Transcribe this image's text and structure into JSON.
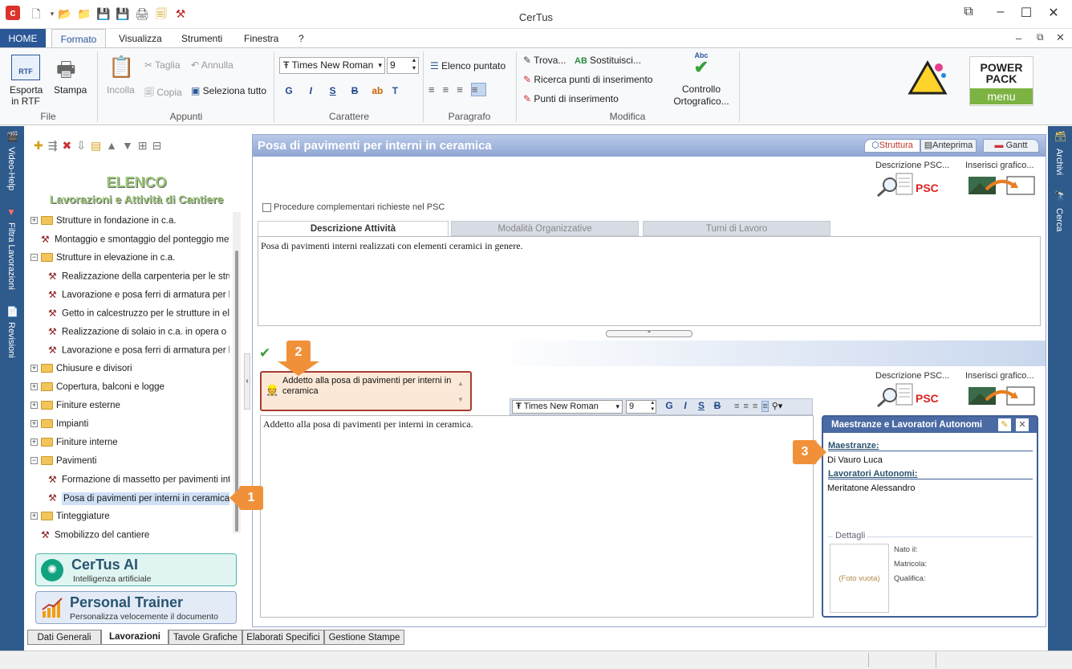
{
  "window": {
    "title": "CerTus"
  },
  "ribbon_tabs": [
    "HOME",
    "Formato",
    "Visualizza",
    "Strumenti",
    "Finestra",
    "?"
  ],
  "ribbon": {
    "file": {
      "label": "File",
      "esporta": [
        "Esporta",
        "in RTF"
      ],
      "stampa": "Stampa"
    },
    "appunti": {
      "label": "Appunti",
      "incolla": "Incolla",
      "taglia": "Taglia",
      "annulla": "Annulla",
      "copia": "Copia",
      "seleziona": "Seleziona tutto"
    },
    "carattere": {
      "label": "Carattere",
      "font": "Times New Roman",
      "size": "9",
      "styles": [
        "G",
        "I",
        "S",
        "B"
      ]
    },
    "paragrafo": {
      "label": "Paragrafo",
      "elenco": "Elenco puntato"
    },
    "modifica": {
      "label": "Modifica",
      "trova": "Trova...",
      "sostituisci": "Sostituisci...",
      "ricerca": "Ricerca punti di inserimento",
      "punti": "Punti di inserimento",
      "controllo": [
        "Controllo",
        "Ortografico..."
      ]
    },
    "powerpack": [
      "POWER",
      "PACK",
      "menu"
    ]
  },
  "left_sidebar": [
    "Video-Help",
    "Filtra Lavorazioni",
    "Revisioni"
  ],
  "right_sidebar": [
    "Archivi",
    "Cerca"
  ],
  "elenco": {
    "title": "ELENCO",
    "subtitle": "Lavorazioni e Attività di Cantiere"
  },
  "tree": [
    {
      "label": "Strutture in fondazione in c.a.",
      "type": "folder",
      "exp": "+",
      "level": 0
    },
    {
      "label": "Montaggio e smontaggio del ponteggio metallico",
      "type": "item",
      "level": 0
    },
    {
      "label": "Strutture in elevazione in c.a.",
      "type": "folder",
      "exp": "−",
      "level": 0
    },
    {
      "label": "Realizzazione della carpenteria per le strutture",
      "type": "item",
      "level": 1
    },
    {
      "label": "Lavorazione e posa ferri di armatura per le",
      "type": "item",
      "level": 1
    },
    {
      "label": "Getto in calcestruzzo per le strutture in elevazione",
      "type": "item",
      "level": 1
    },
    {
      "label": "Realizzazione di solaio in c.a. in opera o",
      "type": "item",
      "level": 1
    },
    {
      "label": "Lavorazione e posa ferri di armatura per le",
      "type": "item",
      "level": 1
    },
    {
      "label": "Chiusure e divisori",
      "type": "folder",
      "exp": "+",
      "level": 0
    },
    {
      "label": "Copertura, balconi e logge",
      "type": "folder",
      "exp": "+",
      "level": 0
    },
    {
      "label": "Finiture esterne",
      "type": "folder",
      "exp": "+",
      "level": 0
    },
    {
      "label": "Impianti",
      "type": "folder",
      "exp": "+",
      "level": 0
    },
    {
      "label": "Finiture interne",
      "type": "folder",
      "exp": "+",
      "level": 0
    },
    {
      "label": "Pavimenti",
      "type": "folder",
      "exp": "−",
      "level": 0
    },
    {
      "label": "Formazione di massetto per pavimenti interni",
      "type": "item",
      "level": 1
    },
    {
      "label": "Posa di pavimenti per interni in ceramica",
      "type": "item",
      "level": 1,
      "selected": true
    },
    {
      "label": "Tinteggiature",
      "type": "folder",
      "exp": "+",
      "level": 0
    },
    {
      "label": "Smobilizzo del cantiere",
      "type": "item",
      "level": 0
    }
  ],
  "certus_ai": {
    "title": "CerTus AI",
    "subtitle": "Intelligenza artificiale"
  },
  "personal_trainer": {
    "title": "Personal Trainer",
    "subtitle": "Personalizza velocemente il documento"
  },
  "bottom_tabs": [
    "Dati Generali",
    "Lavorazioni",
    "Tavole Grafiche",
    "Elaborati Specifici",
    "Gestione Stampe"
  ],
  "main": {
    "title": "Posa di pavimenti per interni in ceramica",
    "view_tabs": [
      "Struttura",
      "Anteprima",
      "Gantt"
    ],
    "descr_psc": "Descrizione PSC...",
    "inserisci": "Inserisci grafico...",
    "psc": "PSC",
    "procedure": "Procedure complementari richieste nel PSC",
    "inner_tabs": [
      "Descrizione Attività",
      "Modalità Organizzative",
      "Turni di Lavoro"
    ],
    "description": "Posa di pavimenti interni realizzati con elementi ceramici in genere.",
    "addetto": "Addetto alla posa di pavimenti per interni in ceramica",
    "addetto_text": "Addetto alla posa di pavimenti per interni in ceramica.",
    "editor_font": "Times New Roman",
    "editor_size": "9",
    "editor_styles": [
      "G",
      "I",
      "S",
      "B"
    ]
  },
  "maestranze": {
    "title": "Maestranze e Lavoratori Autonomi",
    "maestranze_label": "Maestranze:",
    "maestranze_value": "Di Vauro Luca",
    "autonomi_label": "Lavoratori Autonomi:",
    "autonomi_value": "Meritatone Alessandro",
    "dettagli": "Dettagli",
    "foto": "(Foto vuota)",
    "nato": "Nato il:",
    "matricola": "Matricola:",
    "qualifica": "Qualifica:"
  },
  "callouts": [
    "1",
    "2",
    "3"
  ]
}
